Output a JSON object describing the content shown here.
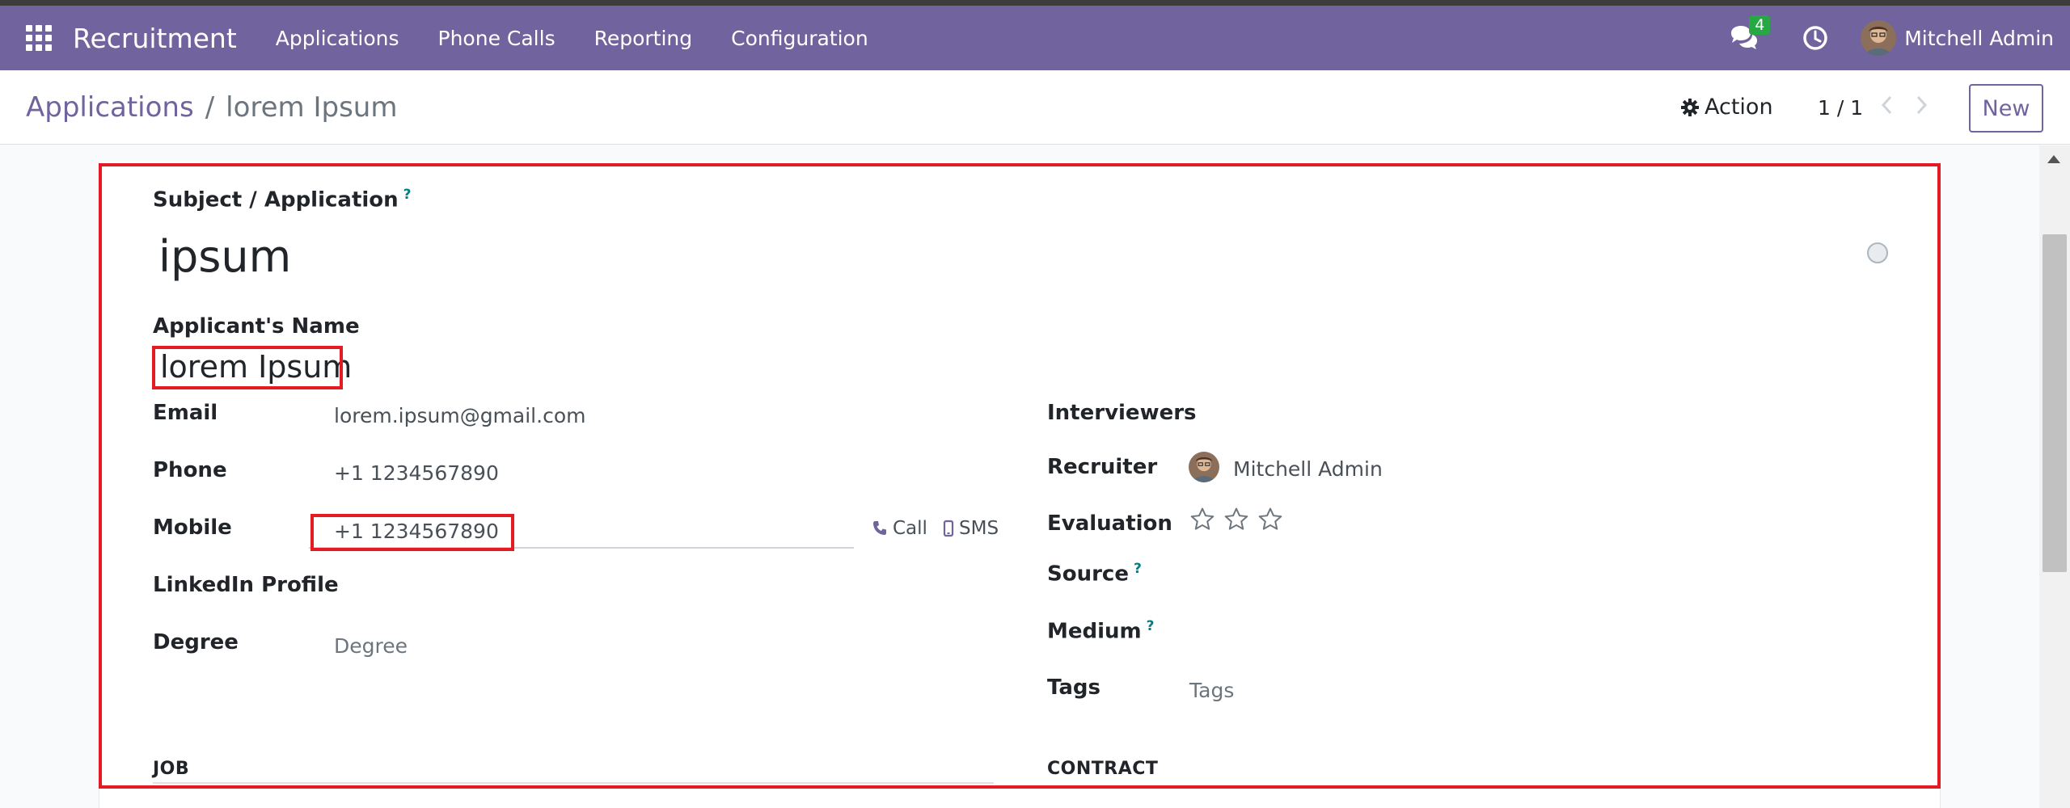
{
  "navbar": {
    "app_name": "Recruitment",
    "menu": [
      "Applications",
      "Phone Calls",
      "Reporting",
      "Configuration"
    ],
    "chat_count": "4",
    "user_name": "Mitchell Admin",
    "color": "#71639e"
  },
  "control_panel": {
    "breadcrumb_parent": "Applications",
    "breadcrumb_separator": "/",
    "breadcrumb_current": "lorem Ipsum",
    "action_label": "Action",
    "pager": "1 / 1",
    "new_label": "New"
  },
  "form": {
    "subject_label": "Subject / Application",
    "subject_help": "?",
    "subject_value": "ipsum",
    "applicant_name_label": "Applicant's Name",
    "applicant_name_value": "lorem Ipsum",
    "left_fields": {
      "email_label": "Email",
      "email_value": "lorem.ipsum@gmail.com",
      "phone_label": "Phone",
      "phone_value": "+1 1234567890",
      "mobile_label": "Mobile",
      "mobile_value": "+1 1234567890",
      "call_label": "Call",
      "sms_label": "SMS",
      "linkedin_label": "LinkedIn Profile",
      "degree_label": "Degree",
      "degree_placeholder": "Degree"
    },
    "right_fields": {
      "interviewers_label": "Interviewers",
      "recruiter_label": "Recruiter",
      "recruiter_value": "Mitchell Admin",
      "evaluation_label": "Evaluation",
      "evaluation_stars": 0,
      "evaluation_max": 3,
      "source_label": "Source",
      "source_help": "?",
      "medium_label": "Medium",
      "medium_help": "?",
      "tags_label": "Tags",
      "tags_placeholder": "Tags"
    },
    "sections": {
      "job": "JOB",
      "contract": "CONTRACT"
    }
  },
  "highlight_color": "#e31b23"
}
